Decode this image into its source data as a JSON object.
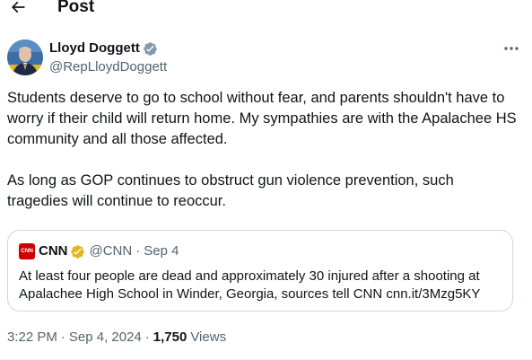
{
  "header": {
    "title": "Post",
    "back_icon": "arrow-left-icon"
  },
  "author": {
    "name": "Lloyd Doggett",
    "handle": "@RepLloydDoggett",
    "verified_color": "#829aab",
    "avatar_icon": "avatar-photo"
  },
  "tweet": {
    "paragraphs": [
      "Students deserve to go to school without fear, and parents shouldn't have to worry if their child will return home. My sympathies are with the Apalachee HS community and all those affected.",
      "As long as GOP continues to obstruct gun violence prevention, such tragedies will continue to reoccur."
    ]
  },
  "quote": {
    "logo_text": "CNN",
    "name": "CNN",
    "handle": "@CNN",
    "separator": "·",
    "date": "Sep 4",
    "text": "At least four people are dead and approximately 30 injured after a shooting at Apalachee High School in Winder, Georgia, sources tell CNN cnn.it/3Mzg5KY",
    "verified_color": "#e2b719",
    "logo_color": "#cc0000"
  },
  "meta": {
    "time": "3:22 PM",
    "separator": "·",
    "date": "Sep 4, 2024",
    "separator2": "·",
    "views_count": "1,750",
    "views_label": "Views"
  },
  "colors": {
    "text_primary": "#0f1419",
    "text_secondary": "#536471",
    "border": "#cfd9de"
  }
}
